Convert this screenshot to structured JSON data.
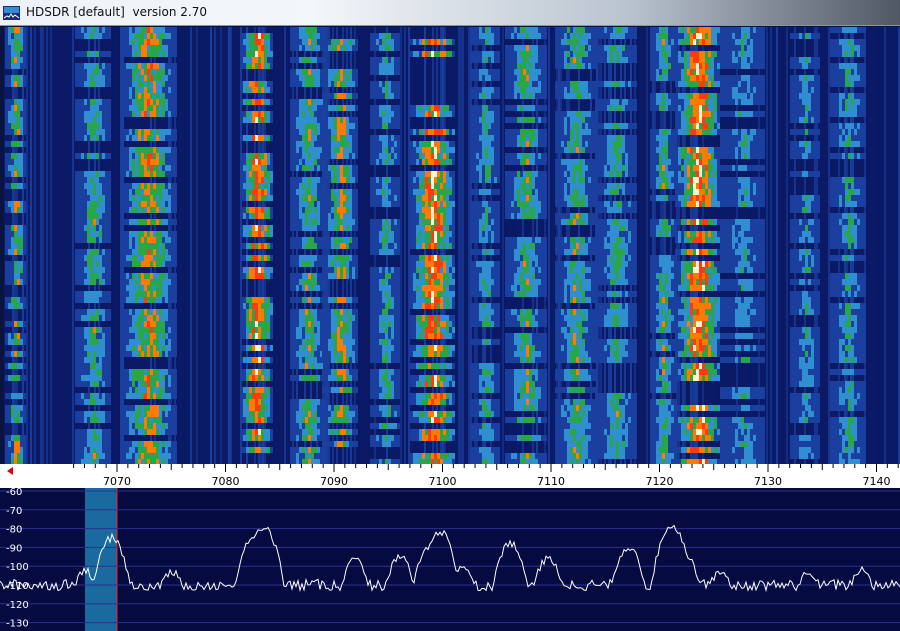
{
  "window": {
    "title": "HDSDR [default]  version 2.70",
    "icon": "hdsdr-app-icon"
  },
  "frequency_scale": {
    "ticks": [
      "7070",
      "7080",
      "7090",
      "7100",
      "7110",
      "7120",
      "7130",
      "7140"
    ],
    "cursor_marker": "red-triangle-left"
  },
  "spectrum": {
    "db_labels": [
      "-60",
      "-70",
      "-80",
      "-90",
      "-100",
      "-110",
      "-120",
      "-130"
    ],
    "passband_color": "#1a6aa0",
    "trace_color": "#ffffff",
    "grid_color": "#2a3290",
    "background_color": "#050a40"
  },
  "waterfall": {
    "palette": [
      "#0b1a66",
      "#1b3f9e",
      "#2f8fd0",
      "#2aa64a",
      "#ff7a00",
      "#ff3a10",
      "#fff4d0"
    ]
  }
}
